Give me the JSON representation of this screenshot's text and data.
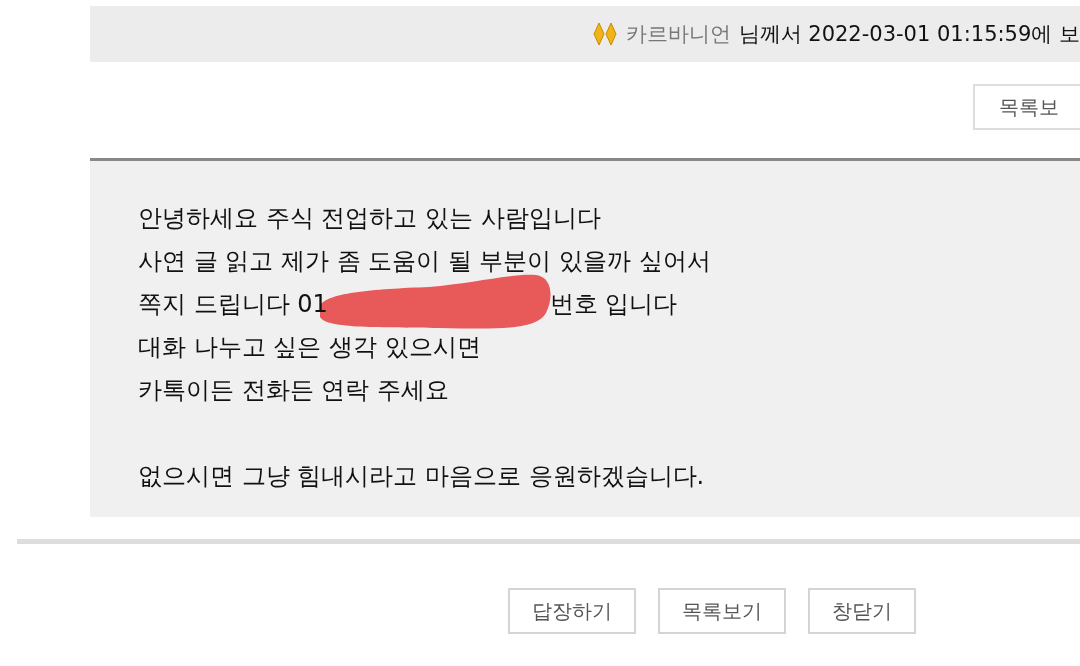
{
  "header": {
    "author": "카르바니언",
    "info": "님께서 2022-03-01 01:15:59에 보"
  },
  "top_button": "목록보",
  "message": {
    "lines": [
      {
        "kind": "text",
        "parts": [
          "안녕하세요 주식 전업하고 있는 사람입니다"
        ]
      },
      {
        "kind": "text",
        "parts": [
          "사연 글 읽고 제가 좀 도움이 될 부분이 있을까 싶어서"
        ]
      },
      {
        "kind": "redacted",
        "parts": [
          "쪽지 드립니다 01",
          "번호 입니다"
        ]
      },
      {
        "kind": "text",
        "parts": [
          "대화 나누고 싶은 생각 있으시면"
        ]
      },
      {
        "kind": "text",
        "parts": [
          "카톡이든 전화든 연락 주세요"
        ]
      },
      {
        "kind": "blank"
      },
      {
        "kind": "text",
        "parts": [
          "없으시면 그냥 힘내시라고 마음으로 응원하겠습니다."
        ]
      }
    ]
  },
  "buttons": [
    "답장하기",
    "목록보기",
    "창닫기"
  ]
}
